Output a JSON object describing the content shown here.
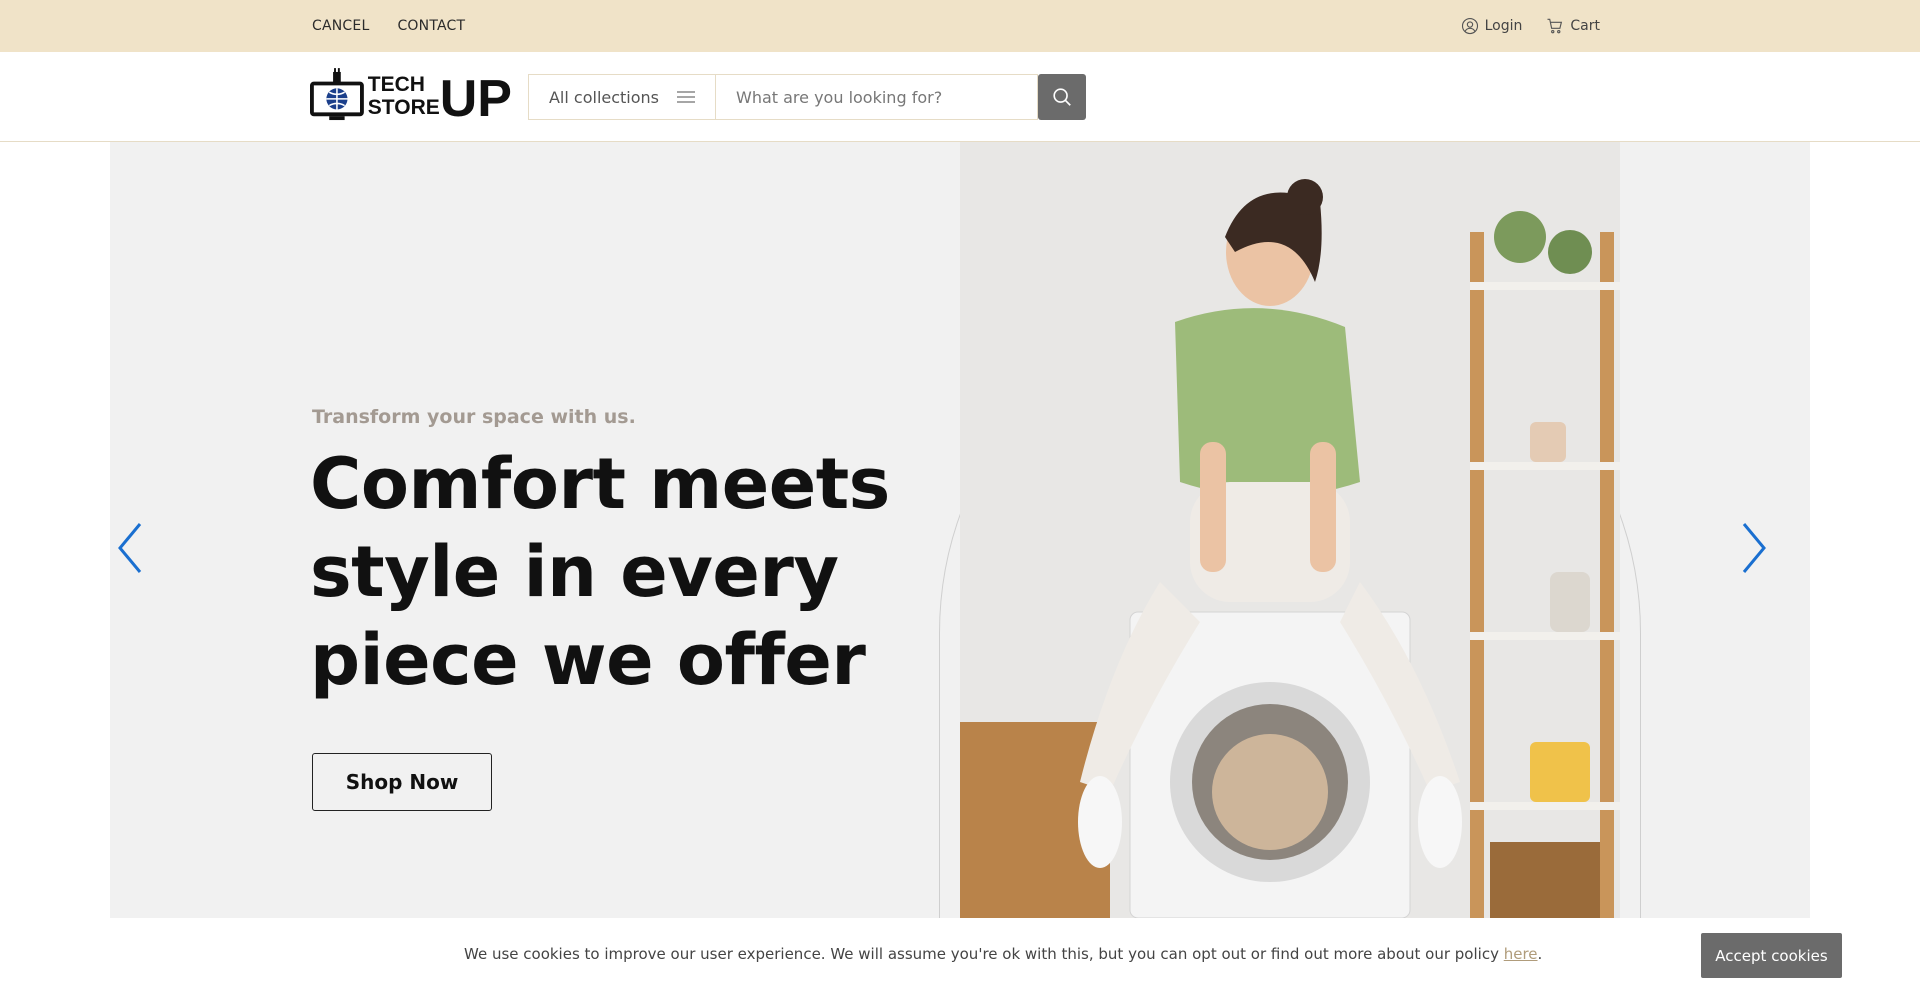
{
  "topbar": {
    "links": [
      "CANCEL",
      "CONTACT"
    ],
    "login_label": "Login",
    "cart_label": "Cart"
  },
  "header": {
    "logo_line1": "TECH",
    "logo_line2": "STORE",
    "logo_up": "UP",
    "collections_label": "All collections",
    "search_placeholder": "What are you looking for?"
  },
  "hero": {
    "subtitle": "Transform your space with us.",
    "headline": "Comfort meets style in every piece we offer",
    "cta_label": "Shop Now"
  },
  "cookie": {
    "message": "We use cookies to improve our user experience. We will assume you're ok with this, but you can opt out or find out more about our policy ",
    "link_label": "here",
    "trailing": ".",
    "accept_label": "Accept cookies"
  },
  "colors": {
    "topbar_bg": "#f0e3c8",
    "hero_bg": "#f1f1f1",
    "accent_blue": "#1a6fd0",
    "button_gray": "#6b6b6b"
  }
}
